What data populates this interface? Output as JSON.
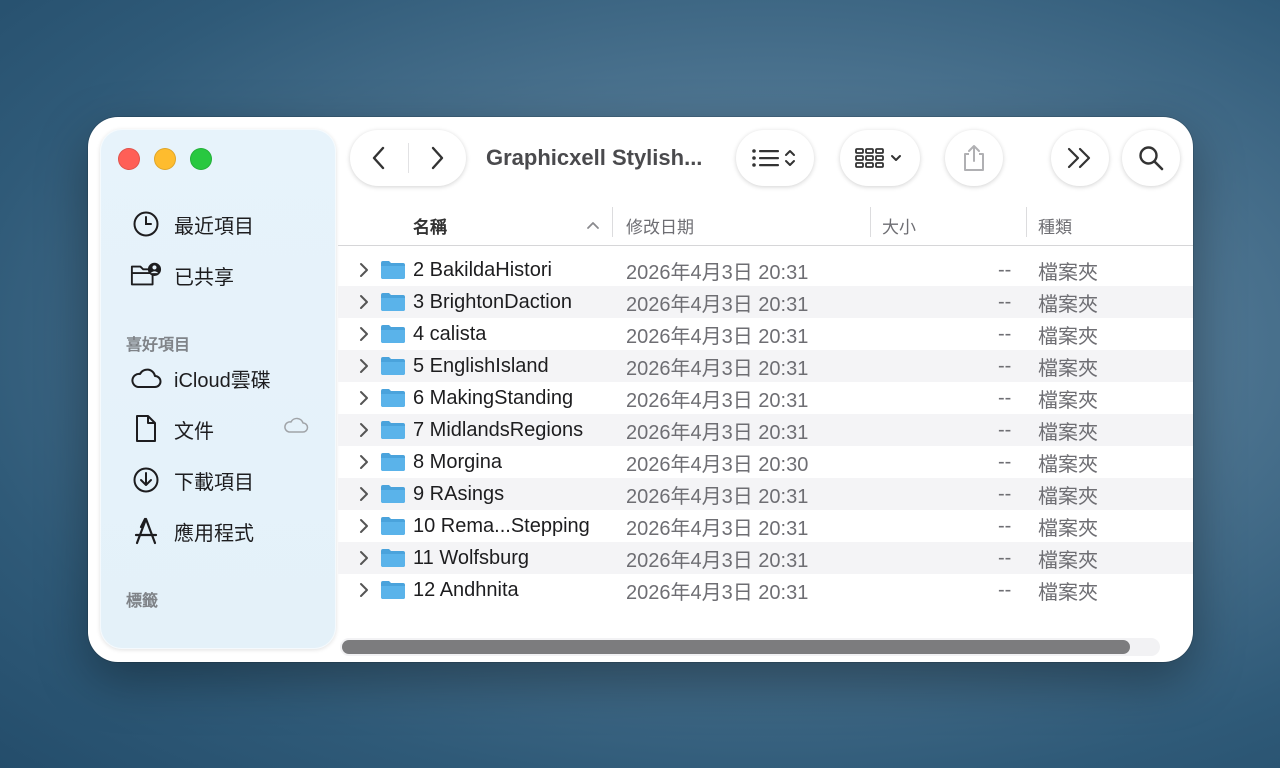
{
  "window": {
    "title": "Graphicxell Stylish..."
  },
  "sidebar": {
    "recents_label": "最近項目",
    "shared_label": "已共享",
    "favorites_header": "喜好項目",
    "favorites": [
      {
        "label": "iCloud雲碟",
        "icon": "cloud-icon"
      },
      {
        "label": "文件",
        "icon": "document-icon"
      },
      {
        "label": "下載項目",
        "icon": "download-icon"
      },
      {
        "label": "應用程式",
        "icon": "applications-icon"
      }
    ],
    "tags_header": "標籤"
  },
  "columns": {
    "name": "名稱",
    "modified": "修改日期",
    "size": "大小",
    "kind": "種類"
  },
  "files": [
    {
      "name": "2 BakildaHistori",
      "modified": "2026年4月3日 20:31",
      "size": "--",
      "kind": "檔案夾"
    },
    {
      "name": "3 BrightonDaction",
      "modified": "2026年4月3日 20:31",
      "size": "--",
      "kind": "檔案夾"
    },
    {
      "name": "4 calista",
      "modified": "2026年4月3日 20:31",
      "size": "--",
      "kind": "檔案夾"
    },
    {
      "name": "5 EnglishIsland",
      "modified": "2026年4月3日 20:31",
      "size": "--",
      "kind": "檔案夾"
    },
    {
      "name": "6 MakingStanding",
      "modified": "2026年4月3日 20:31",
      "size": "--",
      "kind": "檔案夾"
    },
    {
      "name": "7 MidlandsRegions",
      "modified": "2026年4月3日 20:31",
      "size": "--",
      "kind": "檔案夾"
    },
    {
      "name": "8 Morgina",
      "modified": "2026年4月3日 20:30",
      "size": "--",
      "kind": "檔案夾"
    },
    {
      "name": "9 RAsings",
      "modified": "2026年4月3日 20:31",
      "size": "--",
      "kind": "檔案夾"
    },
    {
      "name": "10 Rema...Stepping",
      "modified": "2026年4月3日 20:31",
      "size": "--",
      "kind": "檔案夾"
    },
    {
      "name": "11 Wolfsburg",
      "modified": "2026年4月3日 20:31",
      "size": "--",
      "kind": "檔案夾"
    },
    {
      "name": "12 Andhnita",
      "modified": "2026年4月3日 20:31",
      "size": "--",
      "kind": "檔案夾"
    }
  ],
  "colors": {
    "folder": "#5ab3ea",
    "folder_tab": "#4aa3dc",
    "close": "#ff5f57",
    "minimize": "#febc2e",
    "zoom": "#28c840"
  }
}
